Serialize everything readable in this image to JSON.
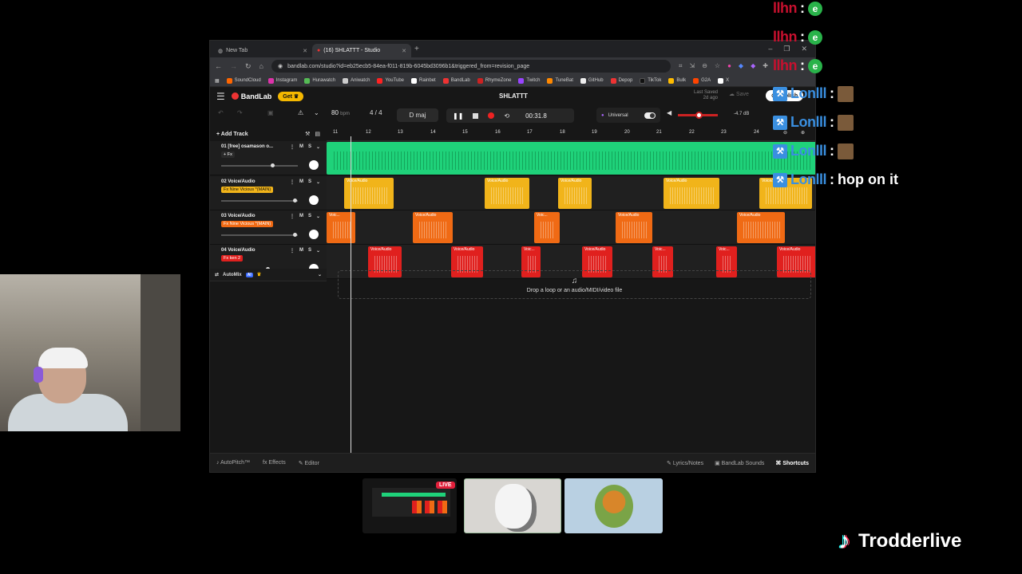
{
  "browser": {
    "tabs": [
      {
        "label": "New Tab",
        "active": false
      },
      {
        "label": "(16) SHLATTT - Studio",
        "active": true
      }
    ],
    "url": "bandlab.com/studio?id=eb25ecb5-84ea-f011-819b-6045bd3096b1&triggered_from=revision_page",
    "bookmarks": [
      "SoundCloud",
      "Instagram",
      "Hurawatch",
      "Aniwatch",
      "YouTube",
      "Rainbet",
      "BandLab",
      "RhymeZone",
      "Twitch",
      "TuneBat",
      "GitHub",
      "Depop",
      "TikTok",
      "Bulk",
      "G2A",
      "X"
    ]
  },
  "app": {
    "logo": "BandLab",
    "get_label": "Get",
    "project_title": "SHLATTT",
    "last_saved_label": "Last Saved",
    "last_saved_value": "2d ago",
    "save_label": "Save",
    "publish_label": "Publish",
    "bpm_value": "80",
    "bpm_unit": "bpm",
    "time_sig": "4 / 4",
    "key": "D maj",
    "time": "00:31.8",
    "universal_label": "Universal",
    "volume_db": "-4.7 dB",
    "volume_level": 0.5,
    "add_track_label": "Add Track",
    "ruler_marks": [
      "11",
      "12",
      "13",
      "14",
      "15",
      "16",
      "17",
      "18",
      "19",
      "20",
      "21",
      "22",
      "23",
      "24"
    ],
    "tracks": [
      {
        "name": "01  [free] osamason o...",
        "fx": "+ Fx",
        "fx_color": "#2a2a2a",
        "slider": 0.85
      },
      {
        "name": "02  Voice/Audio",
        "fx": "Fx Nine Vicious *(MAIN)",
        "fx_color": "#f1b41a",
        "slider": 0.92
      },
      {
        "name": "03  Voice/Audio",
        "fx": "Fx Nine Vicious *(MAIN)",
        "fx_color": "#f06a14",
        "slider": 0.92
      },
      {
        "name": "04  Voice/Audio",
        "fx": "Fx ken 2",
        "fx_color": "#e0201e",
        "slider": 0.6
      }
    ],
    "clip_label": "Voice/Audio",
    "clip_label_short": "Voic...",
    "automix_label": "AutoMix",
    "automix_ai": "AI",
    "drop_label": "Drop a loop or an audio/MIDI/video file",
    "bottom_left": [
      "AutoPitch™",
      "Effects",
      "Editor"
    ],
    "bottom_right": [
      "Lyrics/Notes",
      "BandLab Sounds",
      "Shortcuts"
    ]
  },
  "chat": [
    {
      "user": "llhn",
      "msg": "",
      "type": "emote"
    },
    {
      "user": "llhn",
      "msg": "",
      "type": "emote"
    },
    {
      "user": "llhn",
      "msg": "",
      "type": "emote"
    },
    {
      "user": "Lonlll",
      "msg": "",
      "type": "avatar"
    },
    {
      "user": "Lonlll",
      "msg": "",
      "type": "avatar"
    },
    {
      "user": "Lonlll",
      "msg": "",
      "type": "avatar"
    },
    {
      "user": "Lonlll",
      "msg": "hop on it",
      "type": "text"
    }
  ],
  "thumbnails": {
    "live_label": "LIVE"
  },
  "brand": {
    "name": "Trodderlive"
  }
}
